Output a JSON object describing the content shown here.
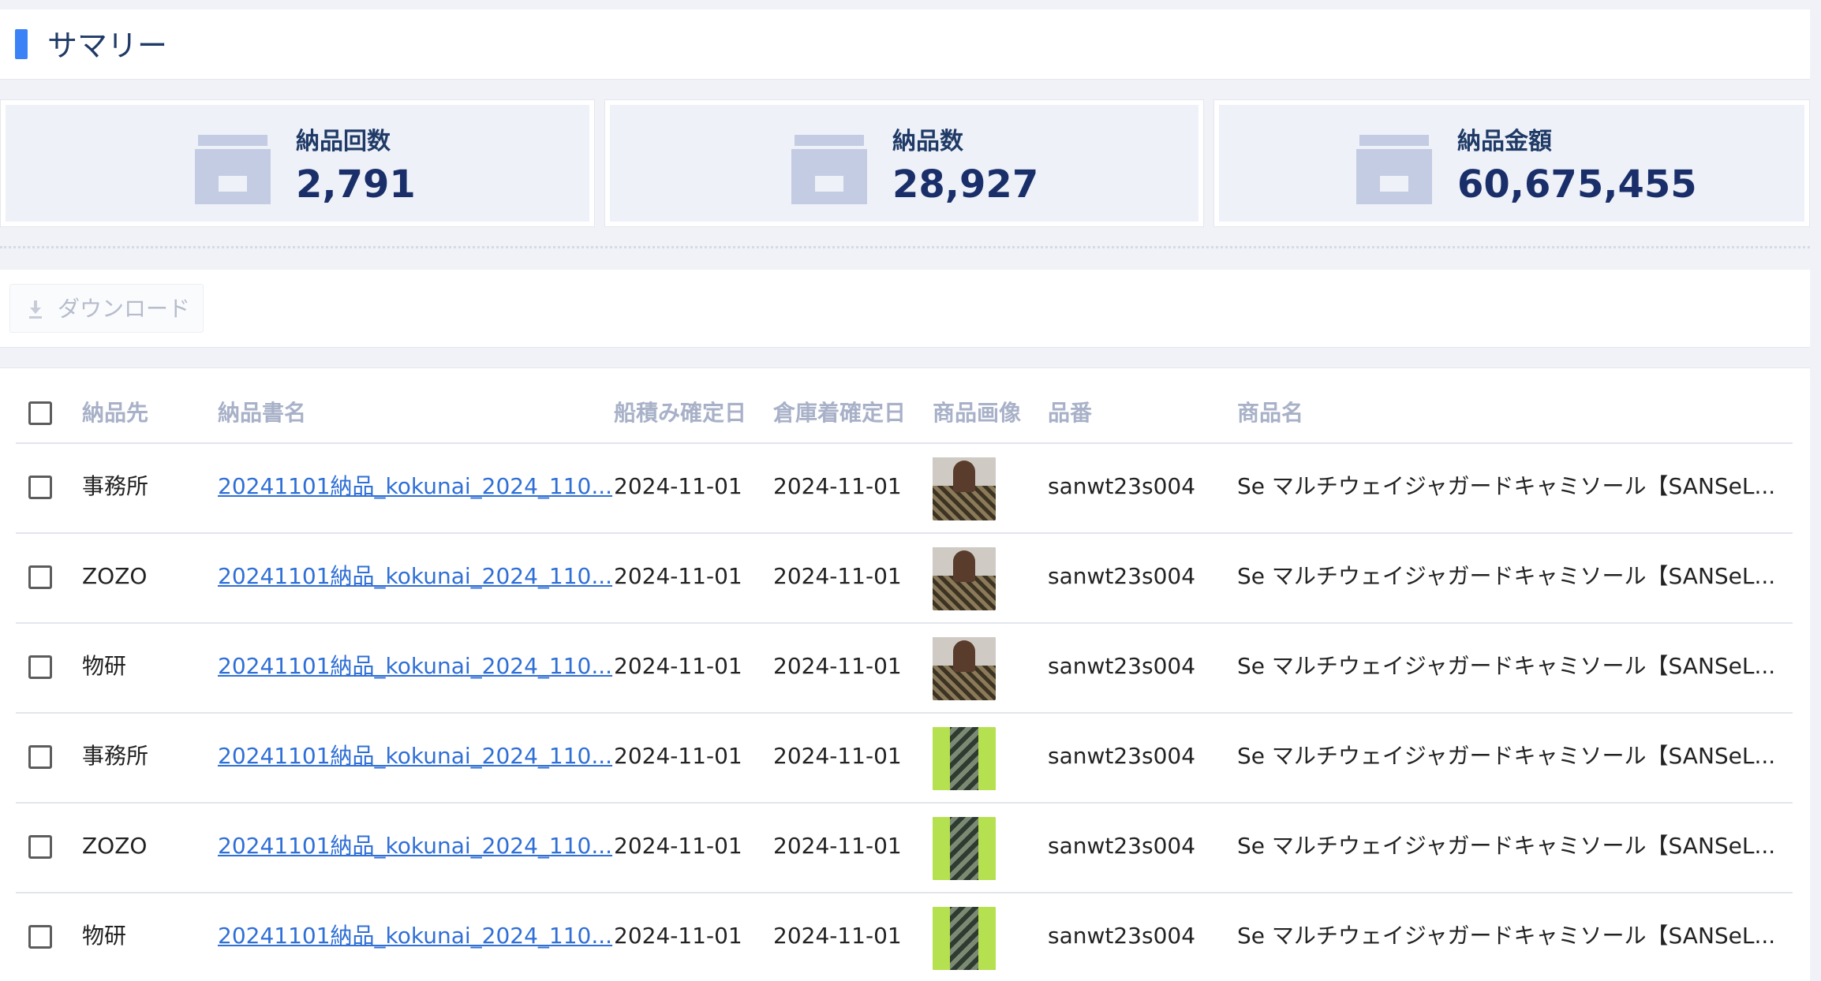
{
  "summary": {
    "title": "サマリー"
  },
  "stats": [
    {
      "icon": "store-icon",
      "label": "納品回数",
      "value": "2,791"
    },
    {
      "icon": "store-icon",
      "label": "納品数",
      "value": "28,927"
    },
    {
      "icon": "store-icon",
      "label": "納品金額",
      "value": "60,675,455"
    }
  ],
  "toolbar": {
    "download_label": "ダウンロード",
    "download_icon": "download-icon"
  },
  "table": {
    "headers": {
      "destination": "納品先",
      "document": "納品書名",
      "ship_date": "船積み確定日",
      "warehouse_date": "倉庫着確定日",
      "image": "商品画像",
      "sku": "品番",
      "product": "商品名"
    },
    "rows": [
      {
        "destination": "事務所",
        "document": "20241101納品_kokunai_2024_110...",
        "ship_date": "2024-11-01",
        "warehouse_date": "2024-11-01",
        "image": "dark",
        "sku": "sanwt23s004",
        "product": "Se マルチウェイジャガードキャミソール【SANSeL..."
      },
      {
        "destination": "ZOZO",
        "document": "20241101納品_kokunai_2024_110...",
        "ship_date": "2024-11-01",
        "warehouse_date": "2024-11-01",
        "image": "dark",
        "sku": "sanwt23s004",
        "product": "Se マルチウェイジャガードキャミソール【SANSeL..."
      },
      {
        "destination": "物研",
        "document": "20241101納品_kokunai_2024_110...",
        "ship_date": "2024-11-01",
        "warehouse_date": "2024-11-01",
        "image": "dark",
        "sku": "sanwt23s004",
        "product": "Se マルチウェイジャガードキャミソール【SANSeL..."
      },
      {
        "destination": "事務所",
        "document": "20241101納品_kokunai_2024_110...",
        "ship_date": "2024-11-01",
        "warehouse_date": "2024-11-01",
        "image": "green",
        "sku": "sanwt23s004",
        "product": "Se マルチウェイジャガードキャミソール【SANSeL..."
      },
      {
        "destination": "ZOZO",
        "document": "20241101納品_kokunai_2024_110...",
        "ship_date": "2024-11-01",
        "warehouse_date": "2024-11-01",
        "image": "green",
        "sku": "sanwt23s004",
        "product": "Se マルチウェイジャガードキャミソール【SANSeL..."
      },
      {
        "destination": "物研",
        "document": "20241101納品_kokunai_2024_110...",
        "ship_date": "2024-11-01",
        "warehouse_date": "2024-11-01",
        "image": "green",
        "sku": "sanwt23s004",
        "product": "Se マルチウェイジャガードキャミソール【SANSeL..."
      }
    ]
  },
  "colors": {
    "accent": "#3b82f6",
    "link": "#2f6fd6",
    "stat_value": "#1a2f6a"
  }
}
